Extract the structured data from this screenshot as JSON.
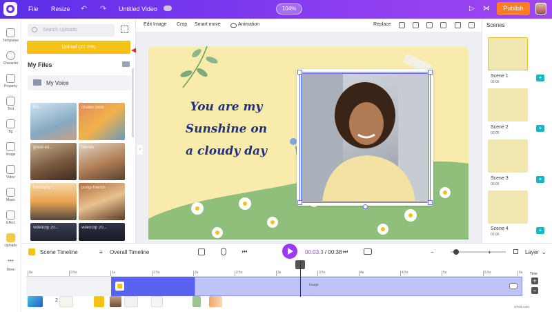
{
  "topbar": {
    "file": "File",
    "resize": "Resize",
    "title": "Untitled Video",
    "zoom": "104%",
    "publish": "Publish"
  },
  "rail": [
    {
      "label": "Templates",
      "icon": "templates-icon"
    },
    {
      "label": "Character",
      "icon": "character-icon"
    },
    {
      "label": "Property",
      "icon": "property-icon"
    },
    {
      "label": "Text",
      "icon": "text-icon"
    },
    {
      "label": "Bg",
      "icon": "background-icon"
    },
    {
      "label": "Image",
      "icon": "image-icon"
    },
    {
      "label": "Video",
      "icon": "video-icon"
    },
    {
      "label": "Music",
      "icon": "music-icon"
    },
    {
      "label": "Effect",
      "icon": "effect-icon"
    },
    {
      "label": "Uploads",
      "icon": "uploads-icon"
    },
    {
      "label": "More",
      "icon": "more-icon"
    }
  ],
  "panel": {
    "search_placeholder": "Search Uploads",
    "upload_label": "Upload",
    "upload_size": "(21 GB)",
    "my_files": "My Files",
    "folder": "My Voice",
    "thumbs": [
      "tthi...",
      "chatter tools",
      "ghost-ed...",
      "friends",
      "friendship t...",
      "pongi-friends",
      "videoclip 20...",
      "videoclip 20..."
    ]
  },
  "toolbar": {
    "edit_image": "Edit Image",
    "crop": "Crop",
    "smart_move": "Smart move",
    "animation": "Animation",
    "replace": "Replace"
  },
  "canvas": {
    "quote_lines": [
      "You are my",
      "Sunshine on",
      "a cloudy day"
    ]
  },
  "scenes": {
    "title": "Scenes",
    "items": [
      {
        "label": "Scene 1",
        "duration": "00:06"
      },
      {
        "label": "Scene 2",
        "duration": "00:06"
      },
      {
        "label": "Scene 3",
        "duration": "00:06"
      },
      {
        "label": "Scene 4",
        "duration": "00:06"
      }
    ]
  },
  "timeline": {
    "scene_timeline": "Scene Timeline",
    "overall_timeline": "Overall Timeline",
    "current_time": "00:03.3",
    "separator": " / ",
    "total_time": "00:38",
    "layer": "Layer",
    "ticks": [
      "0s",
      "0.5s",
      "1s",
      "1.5s",
      "2s",
      "2.5s",
      "3s",
      "3.5s",
      "4s",
      "4.5s",
      "5s",
      "5.5s",
      "6s"
    ],
    "image_label": "Image",
    "time_label": "Time",
    "asset_count": "2"
  },
  "watermark": "wlvid.com",
  "colors": {
    "brand": "#6a35ec",
    "publish": "#ff7d1f",
    "upload": "#f4c218",
    "play": "#9c39f5",
    "quote": "#1f2f86",
    "selection": "#6b73ea"
  }
}
